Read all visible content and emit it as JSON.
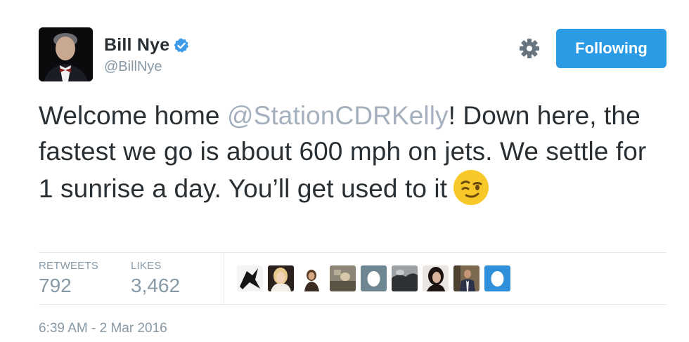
{
  "author": {
    "name": "Bill Nye",
    "handle": "@BillNye",
    "verified": true
  },
  "actions": {
    "follow_label": "Following",
    "settings_icon": "gear-icon"
  },
  "tweet": {
    "text_before": "Welcome home ",
    "mention": "@StationCDRKelly",
    "text_after": "! Down here, the fastest we go is about 600 mph on jets. We settle for 1 sunrise a day. You’ll get used to it",
    "emoji": "winking-face"
  },
  "stats": {
    "retweets_label": "RETWEETS",
    "retweets_count": "792",
    "likes_label": "LIKES",
    "likes_count": "3,462"
  },
  "likers": [
    {
      "avatar": "silhouette-figure"
    },
    {
      "avatar": "blonde-woman"
    },
    {
      "avatar": "woman-dark-background"
    },
    {
      "avatar": "outdoor-photo"
    },
    {
      "avatar": "default-egg"
    },
    {
      "avatar": "landscape-photo"
    },
    {
      "avatar": "dark-haired-woman"
    },
    {
      "avatar": "man-in-suit"
    },
    {
      "avatar": "default-egg-blue"
    }
  ],
  "timestamp": "6:39 AM - 2 Mar 2016",
  "colors": {
    "follow_button": "#2b9be6",
    "mention": "#a4b0bd",
    "muted": "#8899a6",
    "text": "#292f33"
  }
}
